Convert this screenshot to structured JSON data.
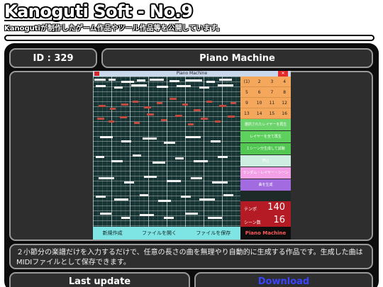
{
  "site": {
    "title": "Kanoguti Soft - No.9",
    "subtitle": "Kanogutiが制作したゲーム作品やツール作品等を公開しています。"
  },
  "work": {
    "id_label": "ID : 329",
    "name": "Piano Machine",
    "description": "２小節分の楽譜だけを入力するだけで、任意の長さの曲を無理やり自動的に生成する作品です。生成した曲はMIDIファイルとして保存できます。",
    "last_update_label": "Last update",
    "download_label": "Download"
  },
  "app": {
    "window_title": "Piano Machine",
    "bottom_buttons": [
      "新規作成",
      "ファイルを開く",
      "ファイルを保存"
    ],
    "number_rows": [
      [
        "(1)",
        "2",
        "3",
        "4"
      ],
      [
        "5",
        "6",
        "7",
        "8"
      ],
      [
        "9",
        "10",
        "11",
        "12"
      ],
      [
        "13",
        "14",
        "15",
        "16"
      ]
    ],
    "side_buttons": [
      {
        "label": "選択されたレイヤーを再生",
        "color": "#6bd46b"
      },
      {
        "label": "レイヤーを全て再生",
        "color": "#5ed05e"
      },
      {
        "label": "１シーン分生成して試聴",
        "color": "#52c852"
      },
      {
        "label": "停止",
        "color": "#cdeee0"
      },
      {
        "label": "ランダム・レイヤー・シーン",
        "color": "#f3a0e6"
      },
      {
        "label": "曲を生成",
        "color": "#a26ce0"
      }
    ],
    "tempo_label": "テンポ",
    "tempo_value": "140",
    "scene_label": "シーン数",
    "scene_value": "16",
    "credit": "Piano Machine"
  },
  "colors": {
    "accent_download": "#3a44ff",
    "panel_bg": "#0c0c0c",
    "box_bg": "#2e2e2e",
    "number_bg": "#f5a75c"
  }
}
